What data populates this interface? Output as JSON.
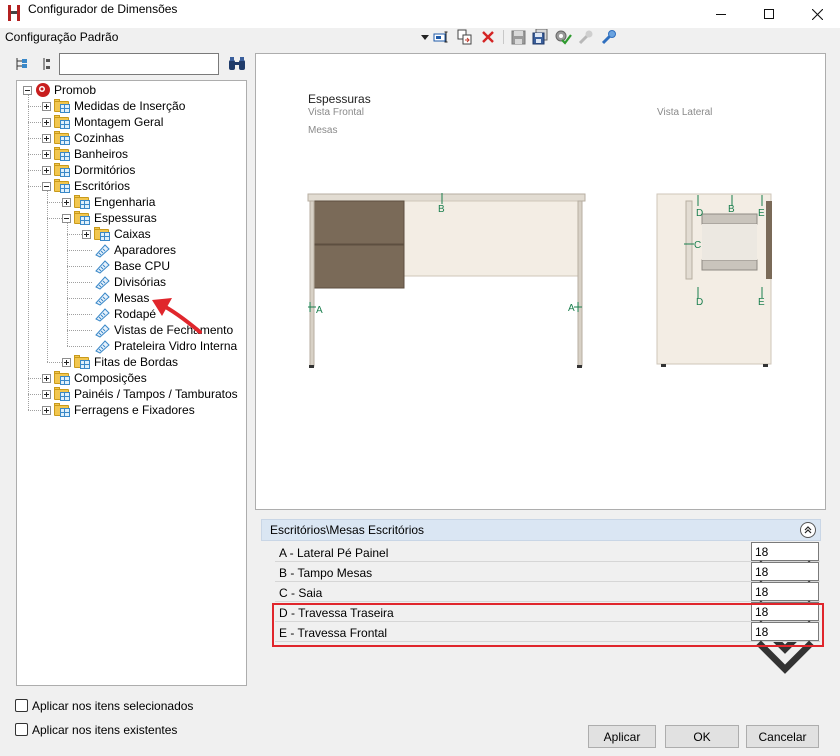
{
  "window": {
    "title": "Configurador de Dimensões"
  },
  "toolbar": {
    "config_name": "Configuração Padrão",
    "icons": [
      "dropdown-arrow-icon",
      "rename-icon",
      "copy-icon",
      "delete-icon",
      "save-icon",
      "save-as-icon",
      "apply-settings-icon",
      "tool-disabled-icon",
      "tool-link-icon"
    ]
  },
  "left_tools": {
    "icons": [
      "expand-tree-icon",
      "collapse-tree-icon",
      "binoculars-icon"
    ],
    "search_value": ""
  },
  "tree": {
    "items": [
      {
        "label": "Promob",
        "level": 0,
        "type": "root",
        "expander": "minus"
      },
      {
        "label": "Medidas de Inserção",
        "level": 1,
        "type": "folder",
        "expander": "plus"
      },
      {
        "label": "Montagem Geral",
        "level": 1,
        "type": "folder",
        "expander": "plus"
      },
      {
        "label": "Cozinhas",
        "level": 1,
        "type": "folder",
        "expander": "plus"
      },
      {
        "label": "Banheiros",
        "level": 1,
        "type": "folder",
        "expander": "plus"
      },
      {
        "label": "Dormitórios",
        "level": 1,
        "type": "folder",
        "expander": "plus"
      },
      {
        "label": "Escritórios",
        "level": 1,
        "type": "folder",
        "expander": "minus"
      },
      {
        "label": "Engenharia",
        "level": 2,
        "type": "folder",
        "expander": "plus"
      },
      {
        "label": "Espessuras",
        "level": 2,
        "type": "folder",
        "expander": "minus"
      },
      {
        "label": "Caixas",
        "level": 3,
        "type": "folder",
        "expander": "plus"
      },
      {
        "label": "Aparadores",
        "level": 3,
        "type": "leaf",
        "expander": "none"
      },
      {
        "label": "Base CPU",
        "level": 3,
        "type": "leaf",
        "expander": "none"
      },
      {
        "label": "Divisórias",
        "level": 3,
        "type": "leaf",
        "expander": "none"
      },
      {
        "label": "Mesas",
        "level": 3,
        "type": "leaf",
        "expander": "none"
      },
      {
        "label": "Rodapé",
        "level": 3,
        "type": "leaf",
        "expander": "none"
      },
      {
        "label": "Vistas de Fechamento",
        "level": 3,
        "type": "leaf",
        "expander": "none"
      },
      {
        "label": "Prateleira Vidro Interna",
        "level": 3,
        "type": "leaf",
        "expander": "none"
      },
      {
        "label": "Fitas de Bordas",
        "level": 2,
        "type": "folder",
        "expander": "plus"
      },
      {
        "label": "Composições",
        "level": 1,
        "type": "folder",
        "expander": "plus"
      },
      {
        "label": "Painéis / Tampos / Tamburatos",
        "level": 1,
        "type": "folder",
        "expander": "plus"
      },
      {
        "label": "Ferragens e Fixadores",
        "level": 1,
        "type": "folder",
        "expander": "plus"
      }
    ]
  },
  "preview": {
    "title": "Espessuras",
    "front_view_label": "Vista Frontal",
    "side_view_label": "Vista Lateral",
    "item_label": "Mesas",
    "front_dims": {
      "a_left": "A",
      "b": "B",
      "a_right": "A"
    },
    "side_dims": {
      "d_top": "D",
      "b": "B",
      "e_top": "E",
      "c": "C",
      "d_bottom": "D",
      "e_bottom": "E"
    }
  },
  "properties": {
    "header": "Escritórios\\Mesas Escritórios",
    "rows": [
      {
        "label": "A - Lateral Pé Painel",
        "value": "18"
      },
      {
        "label": "B - Tampo Mesas",
        "value": "18"
      },
      {
        "label": "C - Saia",
        "value": "18"
      },
      {
        "label": "D - Travessa Traseira",
        "value": "18"
      },
      {
        "label": "E - Travessa Frontal",
        "value": "18"
      }
    ]
  },
  "options": {
    "apply_selected": "Aplicar nos itens selecionados",
    "apply_existing": "Aplicar nos itens existentes"
  },
  "buttons": {
    "apply": "Aplicar",
    "ok": "OK",
    "cancel": "Cancelar"
  },
  "colors": {
    "highlight": "#e0262c",
    "dimension": "#1a7f4e",
    "arrow": "#e0262c",
    "wood": "#7a6a58",
    "panel": "#f3ede4"
  }
}
